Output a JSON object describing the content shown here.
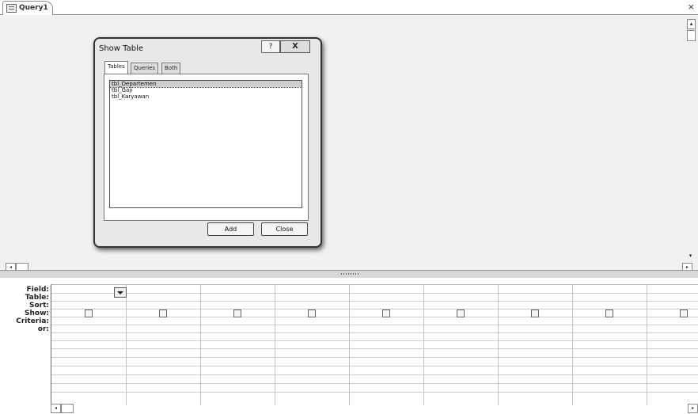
{
  "tab": {
    "label": "Query1",
    "close_glyph": "×"
  },
  "dialog": {
    "title": "Show Table",
    "help_glyph": "?",
    "close_glyph": "X",
    "tabs": [
      {
        "label": "Tables",
        "active": true
      },
      {
        "label": "Queries",
        "active": false
      },
      {
        "label": "Both",
        "active": false
      }
    ],
    "tables": [
      {
        "label": "tbl_Departemen",
        "selected": true
      },
      {
        "label": "tbl_Gaji",
        "selected": false
      },
      {
        "label": "tbl_Karyawan",
        "selected": false
      }
    ],
    "add_label": "Add",
    "close_label": "Close"
  },
  "grid": {
    "row_labels": [
      "Field:",
      "Table:",
      "Sort:",
      "Show:",
      "Criteria:",
      "or:"
    ],
    "column_count": 9,
    "show_checked": [
      false,
      false,
      false,
      false,
      false,
      false,
      false,
      false,
      false
    ]
  },
  "scroll": {
    "left_glyph": "◂",
    "right_glyph": "▸",
    "up_glyph": "▴",
    "down_glyph": "▾"
  },
  "colors": {
    "upper_bg": "#f1f1f1",
    "dialog_bg": "#e8e8e8",
    "selection": "#cfcfcf"
  }
}
